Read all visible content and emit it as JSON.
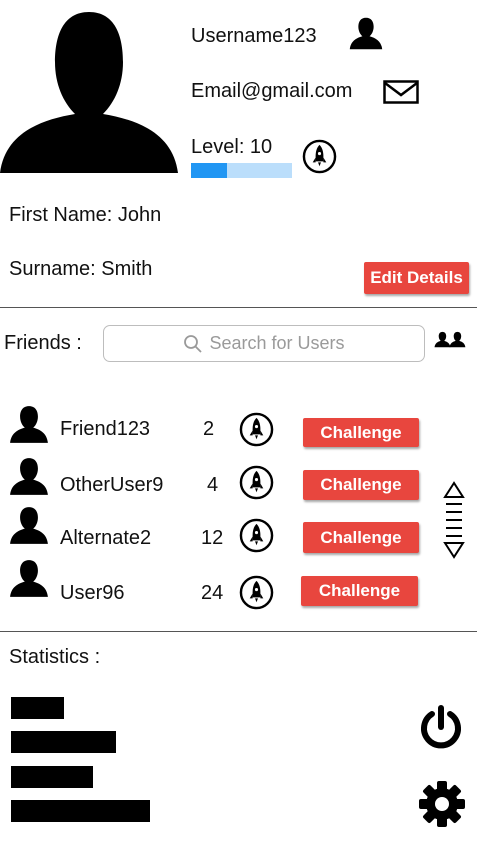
{
  "profile": {
    "username": "Username123",
    "email": "Email@gmail.com",
    "level_label": "Level: 10",
    "level_progress": 0.36,
    "first_name_label": "First Name: John",
    "surname_label": "Surname:  Smith",
    "edit_button_label": "Edit Details"
  },
  "friends": {
    "label": "Friends :",
    "search_placeholder": "Search for Users",
    "list": [
      {
        "name": "Friend123",
        "count": "2",
        "action": "Challenge"
      },
      {
        "name": "OtherUser9",
        "count": "4",
        "action": "Challenge"
      },
      {
        "name": "Alternate2",
        "count": "12",
        "action": "Challenge"
      },
      {
        "name": "User96",
        "count": "24",
        "action": "Challenge"
      }
    ]
  },
  "statistics": {
    "label": "Statistics :",
    "bars": [
      0.28,
      0.55,
      0.43,
      0.73
    ]
  },
  "icons": {
    "avatar": "person-silhouette",
    "user": "person-icon",
    "email": "envelope-icon",
    "level": "rocket-icon",
    "add_friends": "people-icon",
    "search": "search-icon",
    "scroll": "scroll-handle-icon",
    "power": "power-icon",
    "settings": "gear-icon"
  },
  "colors": {
    "accent_red": "#e8463e",
    "progress_fill": "#2196f3",
    "progress_track": "#bbdefb"
  }
}
